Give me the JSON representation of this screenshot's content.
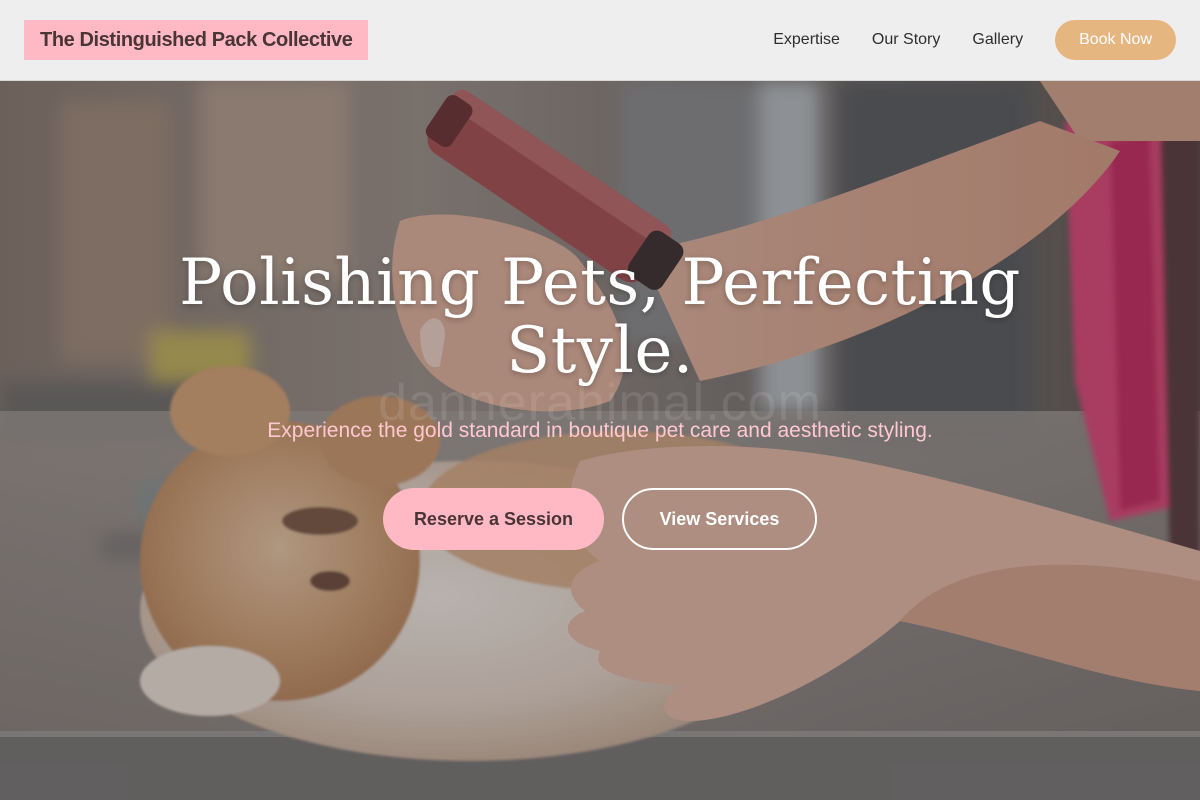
{
  "header": {
    "brand": "The Distinguished Pack Collective",
    "nav": [
      {
        "label": "Expertise"
      },
      {
        "label": "Our Story"
      },
      {
        "label": "Gallery"
      }
    ],
    "cta_label": "Book Now"
  },
  "hero": {
    "title": "Polishing Pets, Perfecting Style.",
    "watermark": "dannerahimal.com",
    "subtitle": "Experience the gold standard in boutique pet care and aesthetic styling.",
    "primary_button": "Reserve a Session",
    "secondary_button": "View Services",
    "image_subject": "groomer-trimming-persian-cat-photo"
  },
  "colors": {
    "brand_pink": "#ffb9c4",
    "gold_accent": "#e5b680",
    "subtitle_pink": "#ffc7cf",
    "header_bg": "#f4f3f3"
  }
}
